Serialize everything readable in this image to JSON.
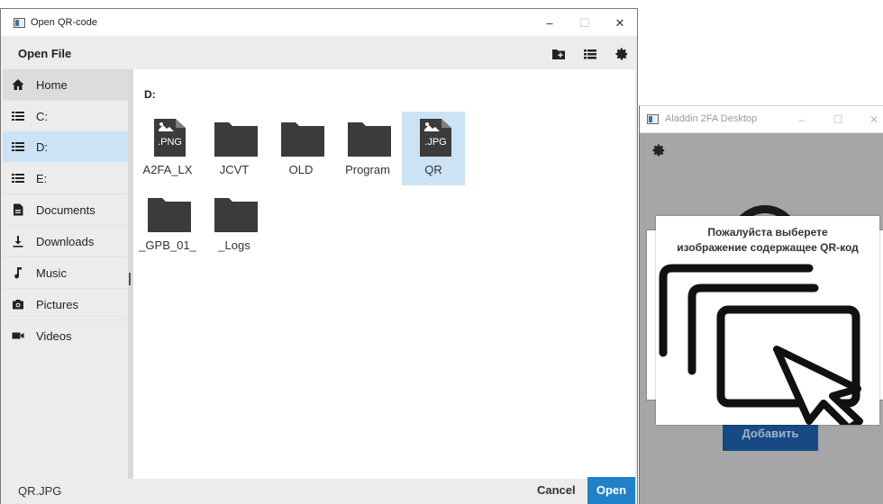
{
  "dialog": {
    "title": "Open QR-code",
    "header_label": "Open File",
    "current_path": "D:",
    "window_controls": {
      "minimize": "–",
      "maximize": "☐",
      "close": "✕"
    }
  },
  "sidebar": {
    "items": [
      {
        "label": "Home",
        "icon": "home-icon"
      },
      {
        "label": "C:",
        "icon": "drive-icon"
      },
      {
        "label": "D:",
        "icon": "drive-icon"
      },
      {
        "label": "E:",
        "icon": "drive-icon"
      },
      {
        "label": "Documents",
        "icon": "document-icon"
      },
      {
        "label": "Downloads",
        "icon": "download-icon"
      },
      {
        "label": "Music",
        "icon": "music-icon"
      },
      {
        "label": "Pictures",
        "icon": "camera-icon"
      },
      {
        "label": "Videos",
        "icon": "video-icon"
      }
    ],
    "selected": "D:"
  },
  "files": [
    {
      "name": "A2FA_LX",
      "type": "file",
      "badge": ".PNG"
    },
    {
      "name": "JCVT",
      "type": "folder"
    },
    {
      "name": "OLD",
      "type": "folder"
    },
    {
      "name": "Program",
      "type": "folder"
    },
    {
      "name": "QR",
      "type": "file",
      "badge": ".JPG",
      "selected": true
    },
    {
      "name": "_GPB_01_",
      "type": "folder"
    },
    {
      "name": "_Logs",
      "type": "folder"
    }
  ],
  "footer": {
    "filename": "QR.JPG",
    "cancel_label": "Cancel",
    "open_label": "Open"
  },
  "background_app": {
    "title": "Aladdin 2FA Desktop",
    "window_controls": {
      "minimize": "–",
      "maximize": "☐",
      "close": "✕"
    },
    "popup_line1": "Пожалуйста выберете",
    "popup_line2": "изображение содержащее QR-код",
    "add_button": "Добавить"
  },
  "colors": {
    "accent": "#1f82c8",
    "selection": "#cce3f5",
    "folder": "#3b3b3b",
    "app_button": "#174a82"
  }
}
